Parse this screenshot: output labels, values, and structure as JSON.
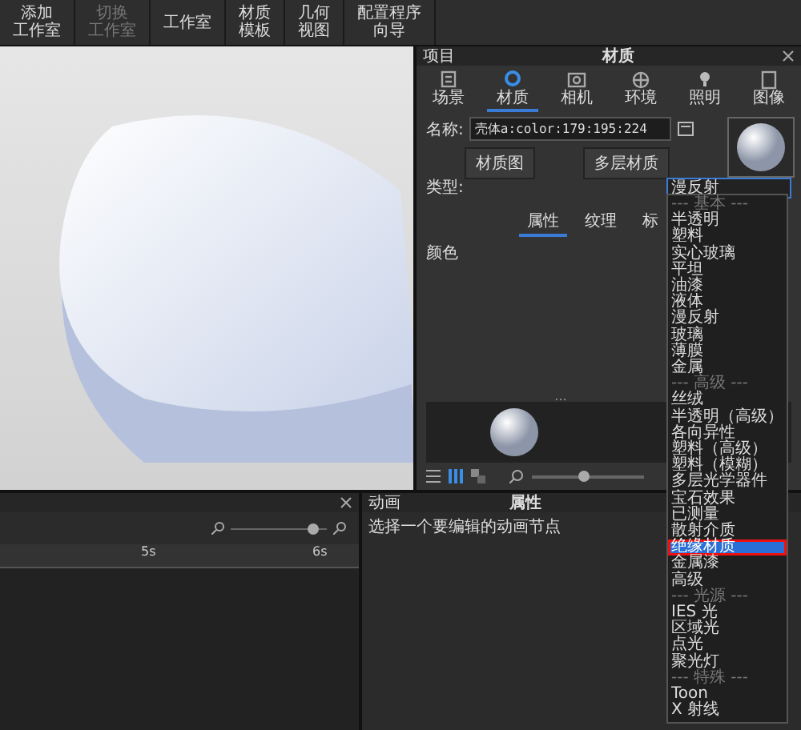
{
  "toolbar": {
    "buttons": [
      {
        "lines": [
          "添加",
          "工作室"
        ],
        "disabled": false
      },
      {
        "lines": [
          "切换",
          "工作室"
        ],
        "disabled": true
      },
      {
        "lines": [
          "工作室"
        ],
        "disabled": false
      },
      {
        "lines": [
          "材质",
          "模板"
        ],
        "disabled": false
      },
      {
        "lines": [
          "几何",
          "视图"
        ],
        "disabled": false
      },
      {
        "lines": [
          "配置程序",
          "向导"
        ],
        "disabled": false
      }
    ]
  },
  "material_panel": {
    "left_title": "项目",
    "title": "材质",
    "tabs": [
      {
        "label": "场景",
        "selected": false
      },
      {
        "label": "材质",
        "selected": true
      },
      {
        "label": "相机",
        "selected": false
      },
      {
        "label": "环境",
        "selected": false
      },
      {
        "label": "照明",
        "selected": false
      },
      {
        "label": "图像",
        "selected": false
      }
    ],
    "name_label": "名称:",
    "name_value": "壳体a:color:179:195:224",
    "buttons": [
      "材质图",
      "多层材质"
    ],
    "type_label": "类型:",
    "type_value": "漫反射",
    "sub_tabs": [
      {
        "label": "属性",
        "selected": true
      },
      {
        "label": "纹理",
        "selected": false
      },
      {
        "label": "标",
        "selected": false
      }
    ],
    "color_label": "颜色",
    "more": "...",
    "thumb_slider": {
      "level": 0.45
    }
  },
  "dropdown": {
    "items": [
      {
        "kind": "header",
        "label": "--- 基本 ---",
        "selected": false
      },
      {
        "kind": "item",
        "label": "半透明",
        "selected": false
      },
      {
        "kind": "item",
        "label": "塑料",
        "selected": false
      },
      {
        "kind": "item",
        "label": "实心玻璃",
        "selected": false
      },
      {
        "kind": "item",
        "label": "平坦",
        "selected": false
      },
      {
        "kind": "item",
        "label": "油漆",
        "selected": false
      },
      {
        "kind": "item",
        "label": "液体",
        "selected": false
      },
      {
        "kind": "item",
        "label": "漫反射",
        "selected": false
      },
      {
        "kind": "item",
        "label": "玻璃",
        "selected": false
      },
      {
        "kind": "item",
        "label": "薄膜",
        "selected": false
      },
      {
        "kind": "item",
        "label": "金属",
        "selected": false
      },
      {
        "kind": "header",
        "label": "--- 高级 ---",
        "selected": false
      },
      {
        "kind": "item",
        "label": "丝绒",
        "selected": false
      },
      {
        "kind": "item",
        "label": "半透明（高级）",
        "selected": false
      },
      {
        "kind": "item",
        "label": "各向异性",
        "selected": false
      },
      {
        "kind": "item",
        "label": "塑料（高级）",
        "selected": false
      },
      {
        "kind": "item",
        "label": "塑料（模糊）",
        "selected": false
      },
      {
        "kind": "item",
        "label": "多层光学器件",
        "selected": false
      },
      {
        "kind": "item",
        "label": "宝石效果",
        "selected": false
      },
      {
        "kind": "item",
        "label": "已测量",
        "selected": false
      },
      {
        "kind": "item",
        "label": "散射介质",
        "selected": false
      },
      {
        "kind": "item",
        "label": "绝缘材质",
        "selected": true
      },
      {
        "kind": "item",
        "label": "金属漆",
        "selected": false
      },
      {
        "kind": "item",
        "label": "高级",
        "selected": false
      },
      {
        "kind": "header",
        "label": "--- 光源 ---",
        "selected": false
      },
      {
        "kind": "item",
        "label": "IES 光",
        "selected": false
      },
      {
        "kind": "item",
        "label": "区域光",
        "selected": false
      },
      {
        "kind": "item",
        "label": "点光",
        "selected": false
      },
      {
        "kind": "item",
        "label": "聚光灯",
        "selected": false
      },
      {
        "kind": "header",
        "label": "--- 特殊 ---",
        "selected": false
      },
      {
        "kind": "item",
        "label": "Toon",
        "selected": false
      },
      {
        "kind": "item",
        "label": "X 射线",
        "selected": false
      }
    ]
  },
  "timeline": {
    "zoom": {
      "level": 0.85
    },
    "ticks": [
      "5s",
      "6s"
    ]
  },
  "animation_panel": {
    "left_title": "动画",
    "title": "属性",
    "hint": "选择一个要编辑的动画节点"
  }
}
